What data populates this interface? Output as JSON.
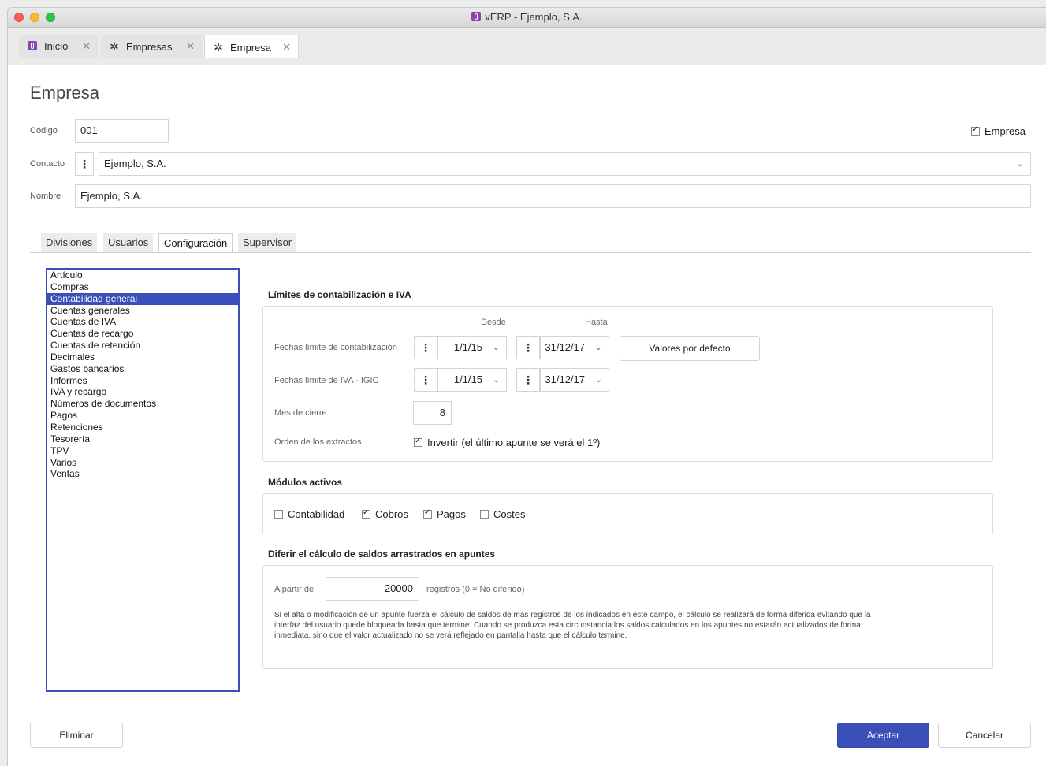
{
  "window": {
    "title": "vERP - Ejemplo, S.A."
  },
  "tabs": [
    {
      "label": "Inicio",
      "icon": "app-icon"
    },
    {
      "label": "Empresas",
      "icon": "gear-icon"
    },
    {
      "label": "Empresa",
      "icon": "gear-icon",
      "active": true
    }
  ],
  "form": {
    "title": "Empresa",
    "codigo_label": "Código",
    "codigo_value": "001",
    "empresa_checkbox_label": "Empresa",
    "empresa_checked": true,
    "contacto_label": "Contacto",
    "contacto_value": "Ejemplo, S.A.",
    "nombre_label": "Nombre",
    "nombre_value": "Ejemplo, S.A."
  },
  "subtabs": [
    "Divisiones",
    "Usuarios",
    "Configuración",
    "Supervisor"
  ],
  "subtab_active": "Configuración",
  "config_list": {
    "items": [
      "Artículo",
      "Compras",
      "Contabilidad general",
      "Cuentas generales",
      "Cuentas de IVA",
      "Cuentas de recargo",
      "Cuentas de retención",
      "Decimales",
      "Gastos bancarios",
      "Informes",
      "IVA y recargo",
      "Números de documentos",
      "Pagos",
      "Retenciones",
      "Tesorería",
      "TPV",
      "Varios",
      "Ventas"
    ],
    "selected": "Contabilidad general"
  },
  "limites": {
    "title": "Límites de contabilización e IVA",
    "desde_header": "Desde",
    "hasta_header": "Hasta",
    "contab_label": "Fechas límite de contabilización",
    "contab_desde": "1/1/15",
    "contab_hasta": "31/12/17",
    "iva_label": "Fechas límite de IVA - IGIC",
    "iva_desde": "1/1/15",
    "iva_hasta": "31/12/17",
    "defaults_button": "Valores por defecto",
    "mes_cierre_label": "Mes de cierre",
    "mes_cierre_value": "8",
    "orden_label": "Orden de los extractos",
    "invertir_label": "Invertir (el último apunte se verá el 1º)",
    "invertir_checked": true
  },
  "modulos": {
    "title": "Módulos activos",
    "items": [
      {
        "label": "Contabilidad",
        "checked": false
      },
      {
        "label": "Cobros",
        "checked": true
      },
      {
        "label": "Pagos",
        "checked": true
      },
      {
        "label": "Costes",
        "checked": false
      }
    ]
  },
  "diferir": {
    "title": "Diferir el cálculo de saldos arrastrados en apuntes",
    "a_partir_label": "A partir de",
    "value": "20000",
    "suffix": "registros (0 = No diferido)",
    "help_lines": [
      "Si el alta o modificación de un apunte fuerza el cálculo de saldos de más registros de los indicados en este campo, el cálculo se realizará de forma diferida evitando que la",
      "interfaz del usuario quede bloqueada hasta que termine. Cuando se produzca esta circunstancia los saldos calculados en los apuntes no estarán actualizados de forma",
      "inmediata, sino que el valor actualizado no se verá reflejado en pantalla hasta que el cálculo termine."
    ]
  },
  "footer": {
    "eliminar": "Eliminar",
    "aceptar": "Aceptar",
    "cancelar": "Cancelar"
  },
  "colors": {
    "accent": "#3b4fb8",
    "close": "#fc5f57",
    "minimize": "#fdbc2e",
    "maximize": "#28c840"
  }
}
